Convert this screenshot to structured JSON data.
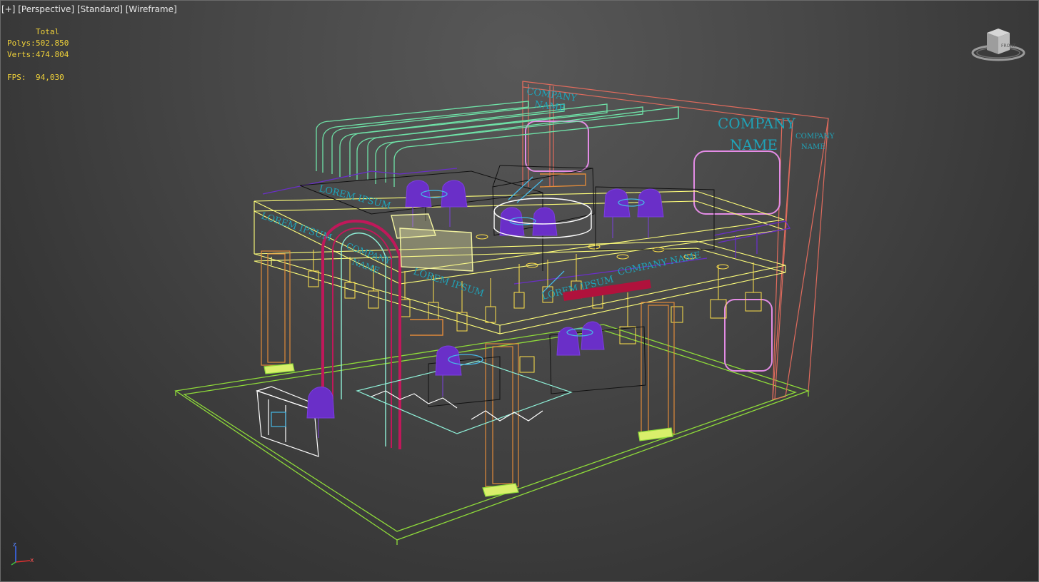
{
  "viewport": {
    "labels": [
      "[+]",
      "[Perspective]",
      "[Standard]",
      "[Wireframe]"
    ]
  },
  "stats": {
    "header": "Total",
    "rows": [
      {
        "key": "Polys:",
        "value": "502.850"
      },
      {
        "key": "Verts:",
        "value": "474.804"
      },
      {
        "key": "FPS:",
        "value": "94,030"
      }
    ]
  },
  "scene_text": {
    "back_wall_main": [
      "COMPANY",
      "NAME"
    ],
    "back_wall_small": [
      "COMPANY",
      "NAME"
    ],
    "top_sign": [
      "COMPANY",
      "NAME"
    ],
    "lorem_1": "LOREM IPSUM",
    "lorem_2": "LOREM IPSUM",
    "lorem_3": "LOREM IPSUM",
    "lorem_4": "LOREM IPSUM",
    "arch_text": [
      "COMPANY",
      "NAME"
    ],
    "front_company": "COMPANY NAME"
  },
  "viewcube": {
    "label": "FRONT"
  },
  "axis": {
    "x": "x",
    "z": "z"
  },
  "colors": {
    "stats": "#f0d23a",
    "label": "#e6e6e6",
    "floor": "#8fdc3a",
    "back_wall": "#e06b5d",
    "ducts": "#6fe3a8",
    "railing": "#ffff7a",
    "pillar": "#e08a3a",
    "arch": "#c0185a",
    "chairs": "#6a2fc8",
    "logo_text": "#1fa3b8"
  }
}
